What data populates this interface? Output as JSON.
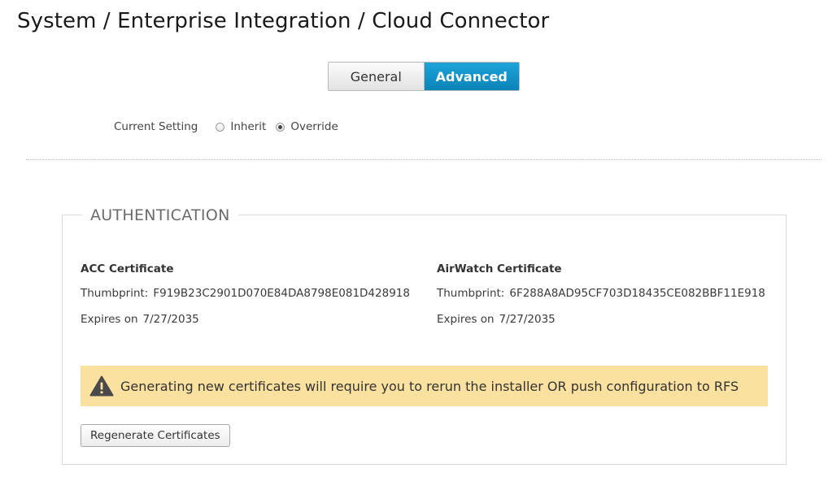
{
  "breadcrumb": "System / Enterprise Integration / Cloud Connector",
  "tabs": [
    {
      "label": "General",
      "active": false
    },
    {
      "label": "Advanced",
      "active": true
    }
  ],
  "current_setting": {
    "label": "Current Setting",
    "options": [
      {
        "label": "Inherit",
        "checked": false
      },
      {
        "label": "Override",
        "checked": true
      }
    ]
  },
  "authentication": {
    "legend": "AUTHENTICATION",
    "acc": {
      "title": "ACC Certificate",
      "thumbprint_label": "Thumbprint:",
      "thumbprint": "F919B23C2901D070E84DA8798E081D428918",
      "expires_label": "Expires on",
      "expires": "7/27/2035"
    },
    "airwatch": {
      "title": "AirWatch Certificate",
      "thumbprint_label": "Thumbprint:",
      "thumbprint": "6F288A8AD95CF703D18435CE082BBF11E918",
      "expires_label": "Expires on",
      "expires": "7/27/2035"
    },
    "warning": {
      "icon": "warning-triangle-icon",
      "text": "Generating new certificates will require you to rerun the installer OR push configuration to RFS"
    },
    "regenerate_label": "Regenerate Certificates"
  },
  "colors": {
    "accent": "#0a8fc6",
    "warning_bg": "#fbe1a0"
  }
}
